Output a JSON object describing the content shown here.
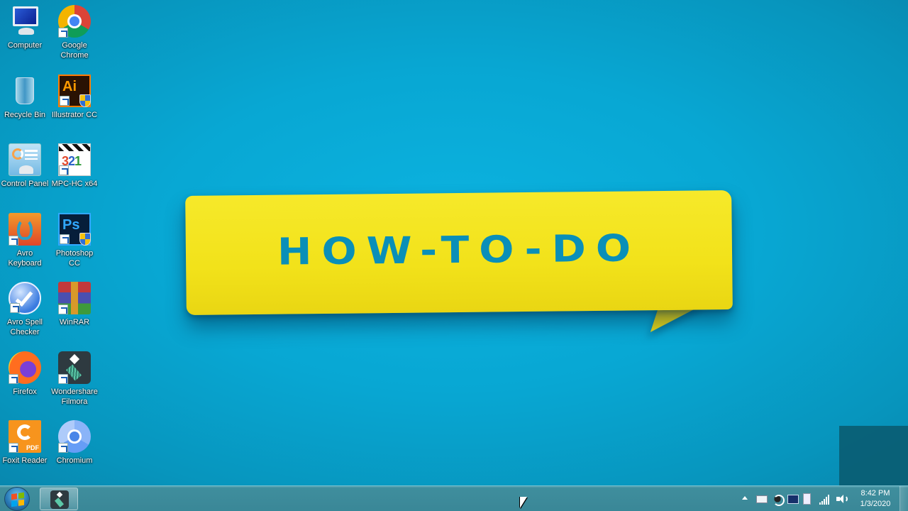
{
  "desktop": {
    "background_color": "#0aa8d4",
    "icons": [
      {
        "label": "Computer",
        "icon": "computer-icon",
        "shortcut": false
      },
      {
        "label": "Google Chrome",
        "icon": "chrome-icon",
        "shortcut": true
      },
      {
        "label": "Recycle Bin",
        "icon": "recycle-bin-icon",
        "shortcut": false
      },
      {
        "label": "Illustrator CC",
        "icon": "illustrator-icon",
        "shortcut": true
      },
      {
        "label": "Control Panel",
        "icon": "control-panel-icon",
        "shortcut": false
      },
      {
        "label": "MPC-HC x64",
        "icon": "mpc-hc-icon",
        "shortcut": true
      },
      {
        "label": "Avro Keyboard",
        "icon": "avro-keyboard-icon",
        "shortcut": true
      },
      {
        "label": "Photoshop CC",
        "icon": "photoshop-icon",
        "shortcut": true
      },
      {
        "label": "Avro Spell Checker",
        "icon": "avro-spell-checker-icon",
        "shortcut": true
      },
      {
        "label": "WinRAR",
        "icon": "winrar-icon",
        "shortcut": true
      },
      {
        "label": "Firefox",
        "icon": "firefox-icon",
        "shortcut": true
      },
      {
        "label": "Wondershare Filmora",
        "icon": "filmora-icon",
        "shortcut": true
      },
      {
        "label": "Foxit Reader",
        "icon": "foxit-reader-icon",
        "shortcut": true
      },
      {
        "label": "Chromium",
        "icon": "chromium-icon",
        "shortcut": true
      }
    ],
    "icon_text": {
      "illustrator": "Ai",
      "photoshop": "Ps",
      "mpc_digits": [
        "3",
        "2",
        "1"
      ],
      "foxit_badge": "PDF"
    }
  },
  "wallpaper": {
    "logo_text": "HOW-TO-DO",
    "logo_bg_color": "#f4e41e",
    "logo_text_color": "#0a8fb8"
  },
  "taskbar": {
    "start_button": "start-orb",
    "pinned_apps": [
      {
        "name": "Wondershare Filmora",
        "icon": "filmora-icon",
        "active": true
      }
    ],
    "tray": {
      "icons": [
        "show-hidden-icons",
        "keyboard-language-icon",
        "avro-keyboard-tray-icon",
        "display-settings-icon",
        "power-icon",
        "network-signal-icon",
        "volume-icon"
      ]
    },
    "clock": {
      "time": "8:42 PM",
      "date": "1/3/2020"
    }
  }
}
